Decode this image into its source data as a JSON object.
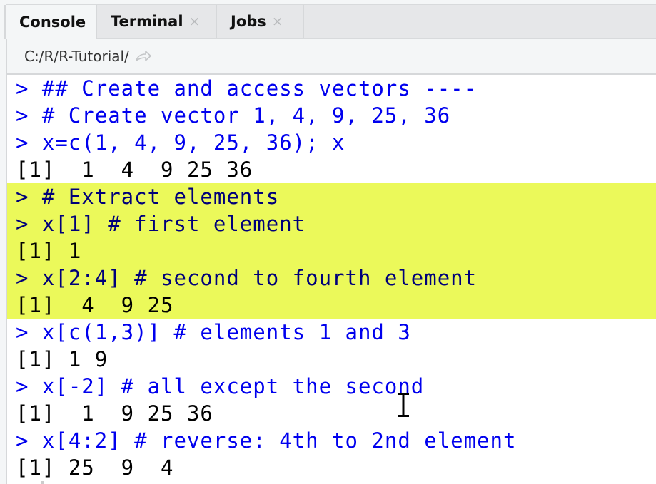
{
  "tabs": [
    {
      "label": "Console",
      "active": true,
      "closable": false
    },
    {
      "label": "Terminal",
      "active": false,
      "closable": true,
      "close_icon": "×"
    },
    {
      "label": "Jobs",
      "active": false,
      "closable": true,
      "close_icon": "×"
    }
  ],
  "path": {
    "text": "C:/R/R-Tutorial/",
    "icon": "go-to-directory-arrow-icon"
  },
  "colors": {
    "input_text": "#0000ee",
    "output_text": "#000000",
    "highlight": "#ebf95a",
    "highlighted_input_text": "#00007a"
  },
  "console": {
    "lines": [
      {
        "type": "input",
        "text": "> ## Create and access vectors ----",
        "highlighted": false
      },
      {
        "type": "input",
        "text": "> # Create vector 1, 4, 9, 25, 36",
        "highlighted": false
      },
      {
        "type": "input",
        "text": "> x=c(1, 4, 9, 25, 36); x",
        "highlighted": false
      },
      {
        "type": "output",
        "text": "[1]  1  4  9 25 36",
        "highlighted": false
      },
      {
        "type": "input",
        "text": "> # Extract elements",
        "highlighted": true
      },
      {
        "type": "input",
        "text": "> x[1] # first element",
        "highlighted": true
      },
      {
        "type": "output",
        "text": "[1] 1",
        "highlighted": true
      },
      {
        "type": "input",
        "text": "> x[2:4] # second to fourth element",
        "highlighted": true
      },
      {
        "type": "output",
        "text": "[1]  4  9 25",
        "highlighted": true
      },
      {
        "type": "input",
        "text": "> x[c(1,3)] # elements 1 and 3",
        "highlighted": false
      },
      {
        "type": "output",
        "text": "[1] 1 9",
        "highlighted": false
      },
      {
        "type": "input",
        "text": "> x[-2] # all except the second",
        "highlighted": false
      },
      {
        "type": "output",
        "text": "[1]  1  9 25 36",
        "highlighted": false
      },
      {
        "type": "input",
        "text": "> x[4:2] # reverse: 4th to 2nd element",
        "highlighted": false
      },
      {
        "type": "output",
        "text": "[1] 25  9  4",
        "highlighted": false
      }
    ]
  },
  "mouse_cursor": "text-ibeam-cursor-icon"
}
